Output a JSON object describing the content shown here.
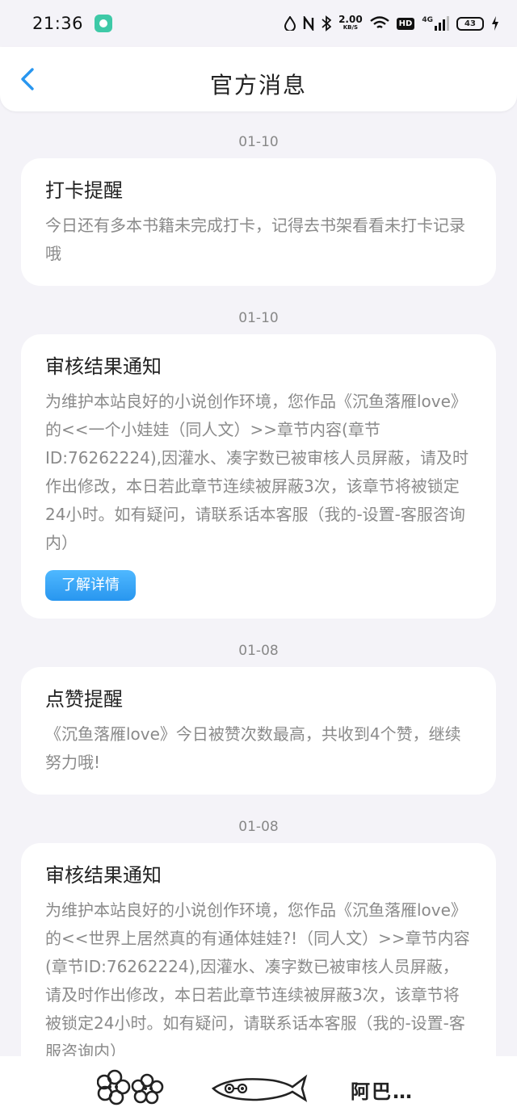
{
  "status_bar": {
    "time": "21:36",
    "net_speed": "2.00",
    "net_unit": "KB/S",
    "hd": "HD",
    "signal": "4G",
    "battery": "43"
  },
  "header": {
    "title": "官方消息"
  },
  "messages": [
    {
      "date": "01-10",
      "title": "打卡提醒",
      "body": "今日还有多本书籍未完成打卡，记得去书架看看未打卡记录哦"
    },
    {
      "date": "01-10",
      "title": "审核结果通知",
      "body": "为维护本站良好的小说创作环境，您作品《沉鱼落雁love》的<<一个小娃娃（同人文）>>章节内容(章节ID:76262224),因灌水、凑字数已被审核人员屏蔽，请及时作出修改，本日若此章节连续被屏蔽3次，该章节将被锁定24小时。如有疑问，请联系话本客服（我的-设置-客服咨询内）",
      "button": "了解详情"
    },
    {
      "date": "01-08",
      "title": "点赞提醒",
      "body": "《沉鱼落雁love》今日被赞次数最高，共收到4个赞，继续努力哦!"
    },
    {
      "date": "01-08",
      "title": "审核结果通知",
      "body": "为维护本站良好的小说创作环境，您作品《沉鱼落雁love》的<<世界上居然真的有通体娃娃?!（同人文）>>章节内容(章节ID:76262224),因灌水、凑字数已被审核人员屏蔽，请及时作出修改，本日若此章节连续被屏蔽3次，该章节将被锁定24小时。如有疑问，请联系话本客服（我的-设置-客服咨询内）"
    }
  ],
  "bottom_bar": {
    "label": "阿巴…"
  },
  "colors": {
    "accent": "#2896ef",
    "background": "#f4f3f8"
  },
  "icons": [
    "back-arrow-icon",
    "flowers-icon",
    "fish-icon"
  ]
}
